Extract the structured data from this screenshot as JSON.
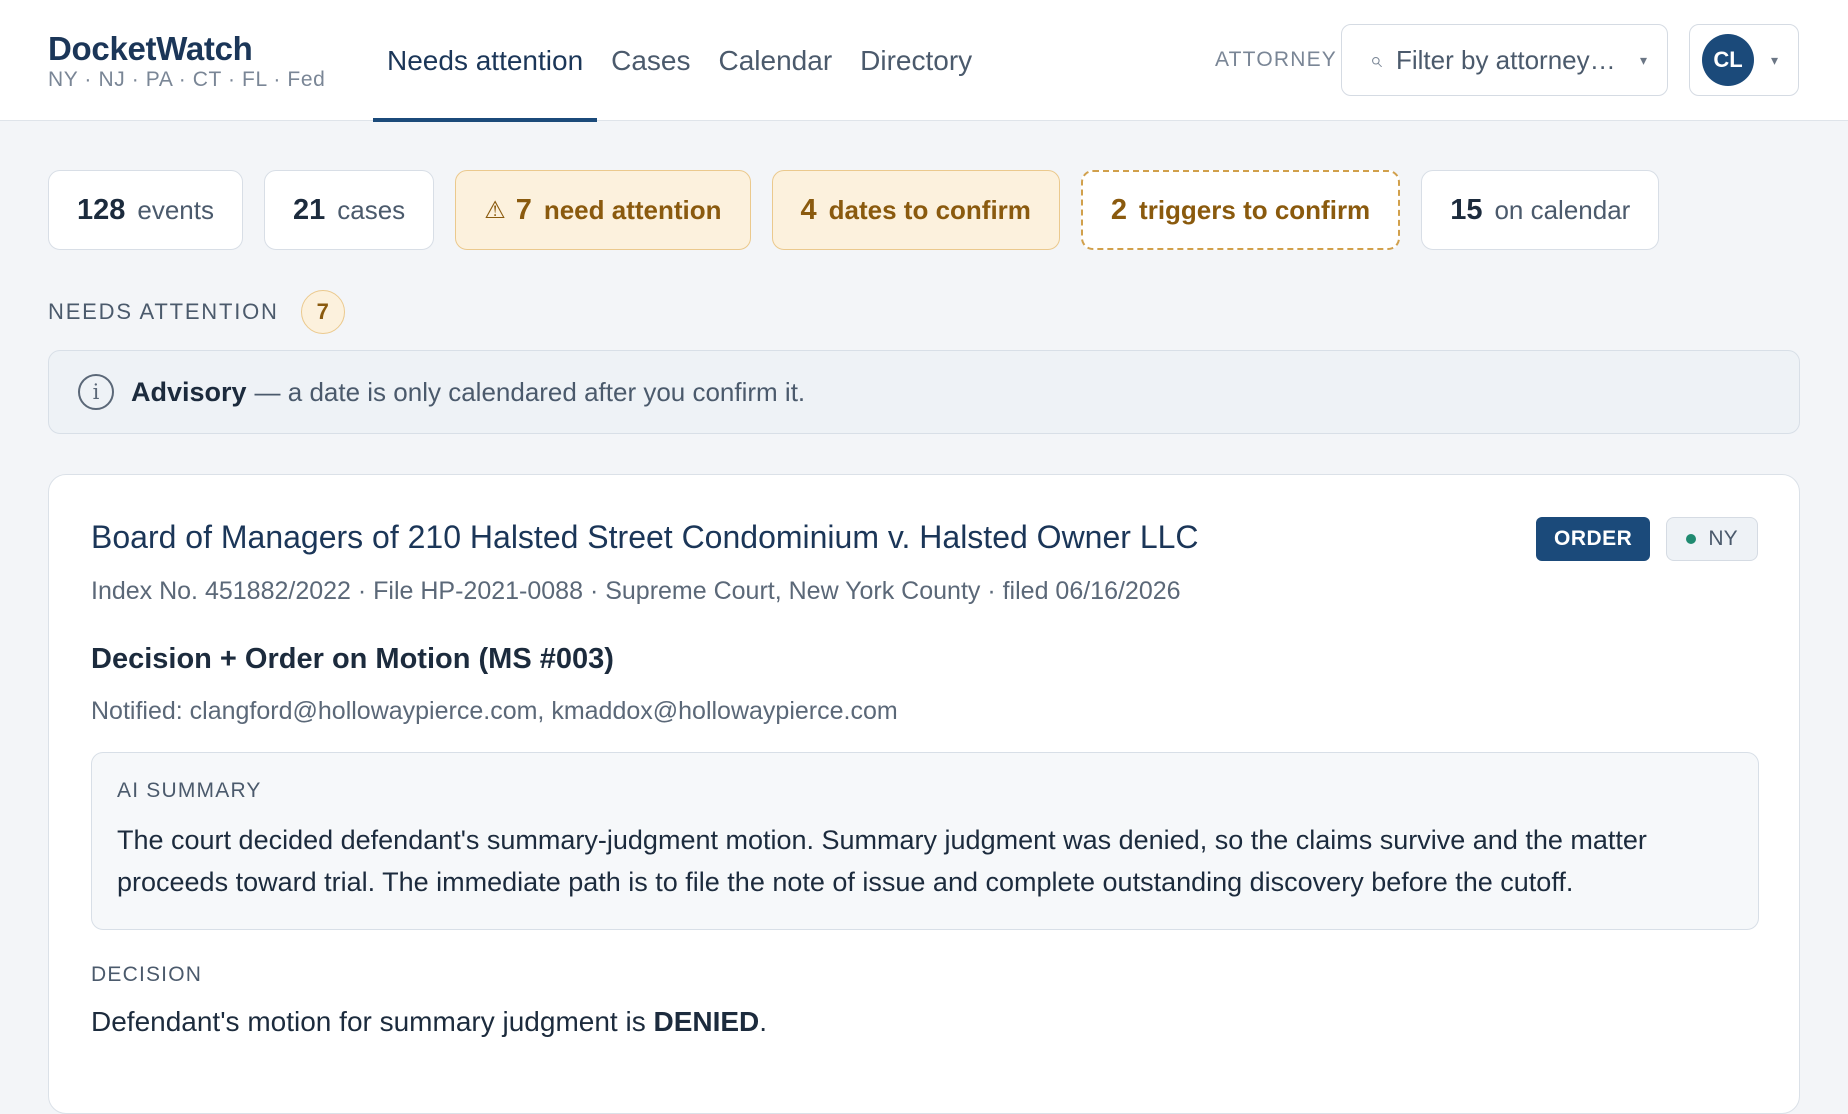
{
  "brand": {
    "name": "DocketWatch",
    "jurisdictions": "NY · NJ · PA · CT · FL · Fed"
  },
  "nav": {
    "items": [
      {
        "label": "Needs attention",
        "active": true
      },
      {
        "label": "Cases",
        "active": false
      },
      {
        "label": "Calendar",
        "active": false
      },
      {
        "label": "Directory",
        "active": false
      }
    ]
  },
  "attorney_filter": {
    "label": "ATTORNEY",
    "placeholder": "Filter by attorney…",
    "search_icon": "search-icon",
    "caret": "▾"
  },
  "user": {
    "initials": "CL",
    "caret": "▾"
  },
  "stats": [
    {
      "num": "128",
      "label": "events"
    },
    {
      "num": "21",
      "label": "cases"
    },
    {
      "num": "7",
      "label": "need attention",
      "icon": "⚠"
    },
    {
      "num": "4",
      "label": "dates to confirm"
    },
    {
      "num": "2",
      "label": "triggers to confirm"
    },
    {
      "num": "15",
      "label": "on calendar"
    }
  ],
  "section": {
    "title": "NEEDS ATTENTION",
    "count": "7"
  },
  "advisory": {
    "title": "Advisory",
    "text": "— a date is only calendared after you confirm it.",
    "icon": "i"
  },
  "card": {
    "case_title": "Board of Managers of 210 Halsted Street Condominium v. Halsted Owner LLC",
    "type_badge": "ORDER",
    "jurisdiction": "NY",
    "meta": "Index No. 451882/2022 · File HP-2021-0088 · Supreme Court, New York County · filed 06/16/2026",
    "event_title": "Decision + Order on Motion (MS #003)",
    "notified": "Notified: clangford@hollowaypierce.com, kmaddox@hollowaypierce.com",
    "ai_summary": {
      "label": "AI SUMMARY",
      "text": "The court decided defendant's summary-judgment motion. Summary judgment was denied, so the claims survive and the matter proceeds toward trial. The immediate path is to file the note of issue and complete outstanding discovery before the cutoff."
    },
    "decision": {
      "label": "DECISION",
      "text_before": "Defendant's motion for summary judgment is ",
      "emphasis": "DENIED",
      "text_after": "."
    }
  },
  "colors": {
    "brand": "#1b3658",
    "accent": "#1b4a7a",
    "warning_bg": "#fcf1dd",
    "warning_text": "#8a5a0e",
    "jurisdiction_dot": "#1f8a70"
  }
}
